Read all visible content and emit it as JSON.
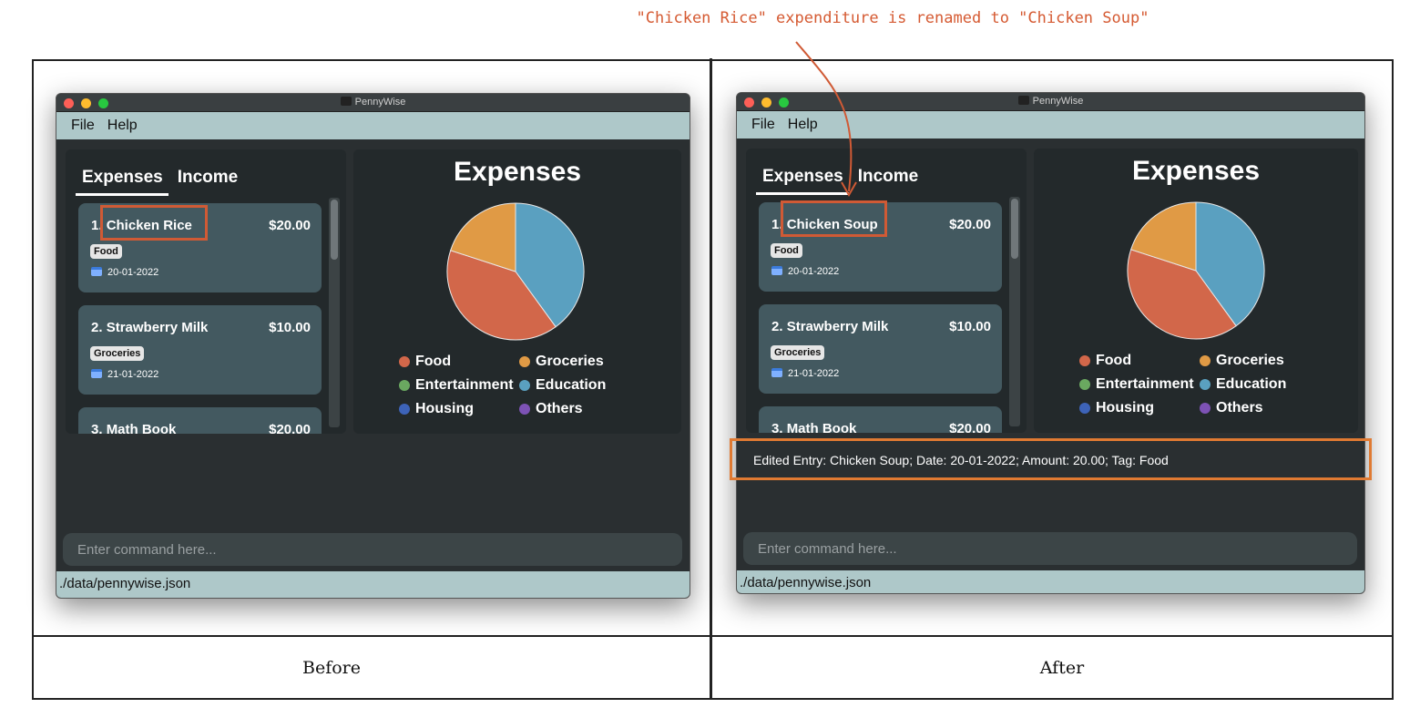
{
  "annotation": "\"Chicken Rice\" expenditure is renamed to \"Chicken Soup\"",
  "captions": {
    "before": "Before",
    "after": "After"
  },
  "colors": {
    "food": "#d2674a",
    "groceries": "#e09a45",
    "entertainment": "#6aa860",
    "education": "#5aa0c0",
    "housing": "#3d63b8",
    "others": "#7d52b5",
    "highlight": "#d05a35"
  },
  "before": {
    "window_title": "PennyWise",
    "menu": [
      "File",
      "Help"
    ],
    "tabs": [
      "Expenses",
      "Income"
    ],
    "entries": [
      {
        "index": "1.",
        "name": "Chicken Rice",
        "amount": "$20.00",
        "tag": "Food",
        "date": "20-01-2022"
      },
      {
        "index": "2.",
        "name": "Strawberry Milk",
        "amount": "$10.00",
        "tag": "Groceries",
        "date": "21-01-2022"
      },
      {
        "index": "3.",
        "name": "Math Book",
        "amount": "$20.00"
      }
    ],
    "chart_title": "Expenses",
    "legend": [
      "Food",
      "Groceries",
      "Entertainment",
      "Education",
      "Housing",
      "Others"
    ],
    "result": "",
    "command_placeholder": "Enter command here...",
    "status": "./data/pennywise.json"
  },
  "after": {
    "window_title": "PennyWise",
    "menu": [
      "File",
      "Help"
    ],
    "tabs": [
      "Expenses",
      "Income"
    ],
    "entries": [
      {
        "index": "1.",
        "name": "Chicken Soup",
        "amount": "$20.00",
        "tag": "Food",
        "date": "20-01-2022"
      },
      {
        "index": "2.",
        "name": "Strawberry Milk",
        "amount": "$10.00",
        "tag": "Groceries",
        "date": "21-01-2022"
      },
      {
        "index": "3.",
        "name": "Math Book",
        "amount": "$20.00"
      }
    ],
    "chart_title": "Expenses",
    "legend": [
      "Food",
      "Groceries",
      "Entertainment",
      "Education",
      "Housing",
      "Others"
    ],
    "result": "Edited Entry: Chicken Soup; Date: 20-01-2022; Amount: 20.00; Tag: Food",
    "command_placeholder": "Enter command here...",
    "status": "./data/pennywise.json"
  },
  "chart_data": [
    {
      "type": "pie",
      "categories": [
        "Food",
        "Groceries",
        "Education"
      ],
      "values": [
        20,
        10,
        20
      ]
    },
    {
      "type": "pie",
      "categories": [
        "Food",
        "Groceries",
        "Education"
      ],
      "values": [
        20,
        10,
        20
      ]
    }
  ]
}
